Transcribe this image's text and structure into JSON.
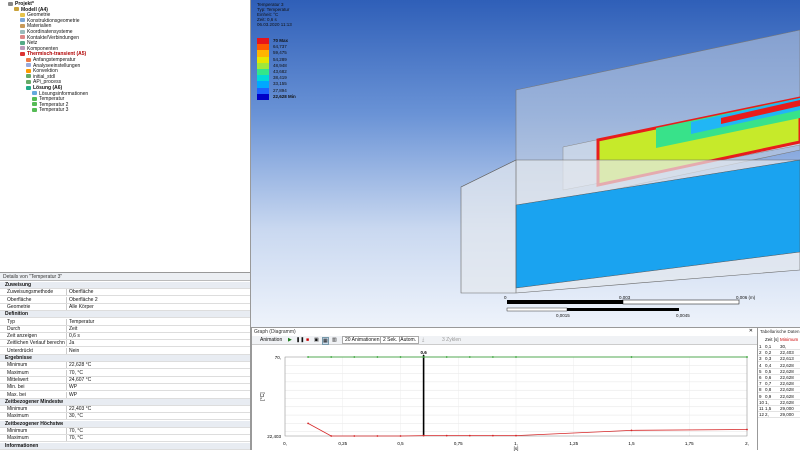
{
  "tree": {
    "items": [
      {
        "label": "Projekt*",
        "bold": true,
        "red": false
      },
      {
        "label": "Modell (A4)",
        "bold": true,
        "red": false
      },
      {
        "label": "Geometrie",
        "bold": false,
        "red": false
      },
      {
        "label": "Konstruktionsgeometrie",
        "bold": false,
        "red": false
      },
      {
        "label": "Materialien",
        "bold": false,
        "red": false
      },
      {
        "label": "Koordinatensysteme",
        "bold": false,
        "red": false
      },
      {
        "label": "Kontakte/Verbindungen",
        "bold": false,
        "red": false
      },
      {
        "label": "Netz",
        "bold": false,
        "red": false
      },
      {
        "label": "Komponenten",
        "bold": false,
        "red": false
      },
      {
        "label": "Thermisch-transient (A5)",
        "bold": true,
        "red": true
      },
      {
        "label": "Anfangstemperatur",
        "bold": false,
        "red": false
      },
      {
        "label": "Analyseeinstellungen",
        "bold": false,
        "red": false
      },
      {
        "label": "Konvektion",
        "bold": false,
        "red": false
      },
      {
        "label": "initial_stdl",
        "bold": false,
        "red": false
      },
      {
        "label": "APi_process",
        "bold": false,
        "red": false
      },
      {
        "label": "Lösung (A6)",
        "bold": true,
        "red": false
      },
      {
        "label": "Lösungsinformationen",
        "bold": false,
        "red": false
      },
      {
        "label": "Temperatur",
        "bold": false,
        "red": false
      },
      {
        "label": "Temperatur 2",
        "bold": false,
        "red": false
      },
      {
        "label": "Temperatur 3",
        "bold": false,
        "red": false
      }
    ]
  },
  "details": {
    "title": "Details von \"Temperatur 3\"",
    "rows": [
      {
        "k": "Zuweisung",
        "v": "",
        "sec": true
      },
      {
        "k": "Zuweisungsmethode",
        "v": "Oberfläche",
        "sec": false
      },
      {
        "k": "Oberfläche",
        "v": "Oberfläche 2",
        "sec": false
      },
      {
        "k": "Geometrie",
        "v": "Alle Körper",
        "sec": false
      },
      {
        "k": "Definition",
        "v": "",
        "sec": true
      },
      {
        "k": "Typ",
        "v": "Temperatur",
        "sec": false
      },
      {
        "k": "Durch",
        "v": "Zeit",
        "sec": false
      },
      {
        "k": "Zeit anzeigen",
        "v": "0,6 s",
        "sec": false
      },
      {
        "k": "Zeitlichen Verlauf berechnen",
        "v": "Ja",
        "sec": false
      },
      {
        "k": "Unterdrückt",
        "v": "Nein",
        "sec": false
      },
      {
        "k": "Ergebnisse",
        "v": "",
        "sec": true
      },
      {
        "k": "Minimum",
        "v": "22,628 °C",
        "sec": false
      },
      {
        "k": "Maximum",
        "v": "70, °C",
        "sec": false
      },
      {
        "k": "Mittelwert",
        "v": "24,607 °C",
        "sec": false
      },
      {
        "k": "Min. bei",
        "v": "WP",
        "sec": false
      },
      {
        "k": "Max. bei",
        "v": "WP",
        "sec": false
      },
      {
        "k": "Zeitbezogener Mindestwert",
        "v": "",
        "sec": true
      },
      {
        "k": "Minimum",
        "v": "22,403 °C",
        "sec": false
      },
      {
        "k": "Maximum",
        "v": "30, °C",
        "sec": false
      },
      {
        "k": "Zeitbezogener Höchstwert",
        "v": "",
        "sec": true
      },
      {
        "k": "Minimum",
        "v": "70, °C",
        "sec": false
      },
      {
        "k": "Maximum",
        "v": "70, °C",
        "sec": false
      },
      {
        "k": "Informationen",
        "v": "",
        "sec": true
      }
    ]
  },
  "viewport": {
    "header": [
      "Temperatur 3",
      "Typ: Temperatur",
      "Einheit: °C",
      "Zeit: 0,6 s",
      "06.03.2020 11:13"
    ],
    "legend": [
      {
        "label": "70 Max",
        "color": "#e8141b"
      },
      {
        "label": "64,737",
        "color": "#ff5a00"
      },
      {
        "label": "59,475",
        "color": "#ffb400"
      },
      {
        "label": "54,289",
        "color": "#e6e600"
      },
      {
        "label": "48,948",
        "color": "#9fe83a"
      },
      {
        "label": "43,682",
        "color": "#33e68b"
      },
      {
        "label": "38,419",
        "color": "#00d9d9"
      },
      {
        "label": "33,155",
        "color": "#00a8ff"
      },
      {
        "label": "27,894",
        "color": "#1e63ff"
      },
      {
        "label": "22,628 Min",
        "color": "#0000c8"
      }
    ],
    "scale": {
      "labels": [
        "0",
        "0,003",
        "0,006 (m)"
      ],
      "sub": [
        "0,0015",
        "0,0045"
      ]
    }
  },
  "graph": {
    "title": "Graph (Diagramm)",
    "toolbar": {
      "animation": "Animation",
      "frames": "20 Animationen",
      "speed": "2 Sek. (Autom.",
      "cycles": "3 Zyklen"
    },
    "ylabel": "[°C]",
    "xlabel": "[s]",
    "marker": "0,6",
    "ytick_top": "70,",
    "ytick_bottom": "22,403",
    "yticks": [
      "65,",
      "60,",
      "55,",
      "50,",
      "45,",
      "40,",
      "35,",
      "30,",
      "25,"
    ]
  },
  "chart_data": {
    "type": "line",
    "xlabel": "[s]",
    "ylabel": "[°C]",
    "xlim": [
      0,
      2
    ],
    "ylim": [
      22.403,
      70
    ],
    "x_ticks": [
      "0,",
      "0,25",
      "0,5",
      "0,75",
      "1,",
      "1,25",
      "1,5",
      "1,75",
      "2,"
    ],
    "series": [
      {
        "color": "#2ea02e",
        "x": [
          0.1,
          0.2,
          0.3,
          0.4,
          0.5,
          0.6,
          0.7,
          0.8,
          0.9,
          1.0,
          1.5,
          2.0
        ],
        "values": [
          70,
          70,
          70,
          70,
          70,
          70,
          70,
          70,
          70,
          70,
          70,
          70
        ]
      },
      {
        "color": "#d62728",
        "x": [
          0.1,
          0.2,
          0.3,
          0.4,
          0.5,
          0.6,
          0.7,
          0.8,
          0.9,
          1.0,
          1.5,
          2.0
        ],
        "values": [
          30,
          22.403,
          22.403,
          22.403,
          22.403,
          22.628,
          22.628,
          22.628,
          22.628,
          22.628,
          25.8,
          26.3
        ]
      }
    ]
  },
  "table": {
    "title": "Tabellarische Daten",
    "header": [
      "",
      "Zeit [s]",
      "Minimum"
    ],
    "rows": [
      [
        "1",
        "0,1",
        "30,"
      ],
      [
        "2",
        "0,2",
        "22,403"
      ],
      [
        "3",
        "0,3",
        "22,613"
      ],
      [
        "4",
        "0,4",
        "22,628"
      ],
      [
        "5",
        "0,5",
        "22,628"
      ],
      [
        "6",
        "0,6",
        "22,628"
      ],
      [
        "7",
        "0,7",
        "22,628"
      ],
      [
        "8",
        "0,8",
        "22,628"
      ],
      [
        "9",
        "0,9",
        "22,628"
      ],
      [
        "10",
        "1,",
        "22,628"
      ],
      [
        "11",
        "1,5",
        "29,000"
      ],
      [
        "12",
        "2,",
        "29,000"
      ]
    ]
  }
}
